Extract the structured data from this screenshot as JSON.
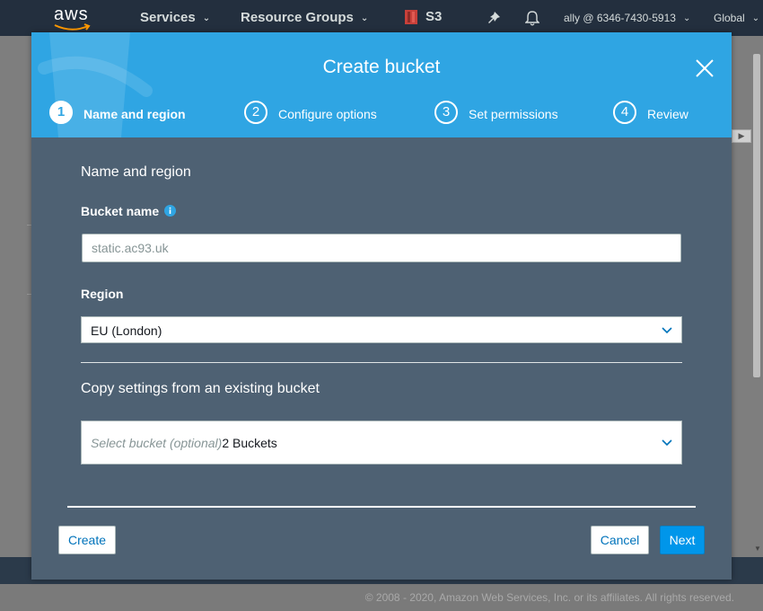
{
  "nav": {
    "logo_text": "aws",
    "services": "Services",
    "resource_groups": "Resource Groups",
    "service_name": "S3",
    "account": "ally @ 6346-7430-5913",
    "region": "Global"
  },
  "modal": {
    "title": "Create bucket",
    "steps": [
      {
        "num": "1",
        "label": "Name and region",
        "active": true
      },
      {
        "num": "2",
        "label": "Configure options",
        "active": false
      },
      {
        "num": "3",
        "label": "Set permissions",
        "active": false
      },
      {
        "num": "4",
        "label": "Review",
        "active": false
      }
    ],
    "section_title": "Name and region",
    "bucket_name_label": "Bucket name",
    "bucket_name_placeholder": "static.ac93.uk",
    "bucket_name_value": "",
    "region_label": "Region",
    "region_value": "EU (London)",
    "copy_title": "Copy settings from an existing bucket",
    "copy_placeholder": "Select bucket (optional)",
    "copy_count": "2 Buckets",
    "create_label": "Create",
    "cancel_label": "Cancel",
    "next_label": "Next"
  },
  "footer": {
    "copyright": "© 2008 - 2020, Amazon Web Services, Inc. or its affiliates. All rights reserved."
  },
  "colors": {
    "nav_bg": "#232f3e",
    "header_blue": "#2fa5e3",
    "modal_body": "#4e6173",
    "primary_button": "#0096ea"
  }
}
